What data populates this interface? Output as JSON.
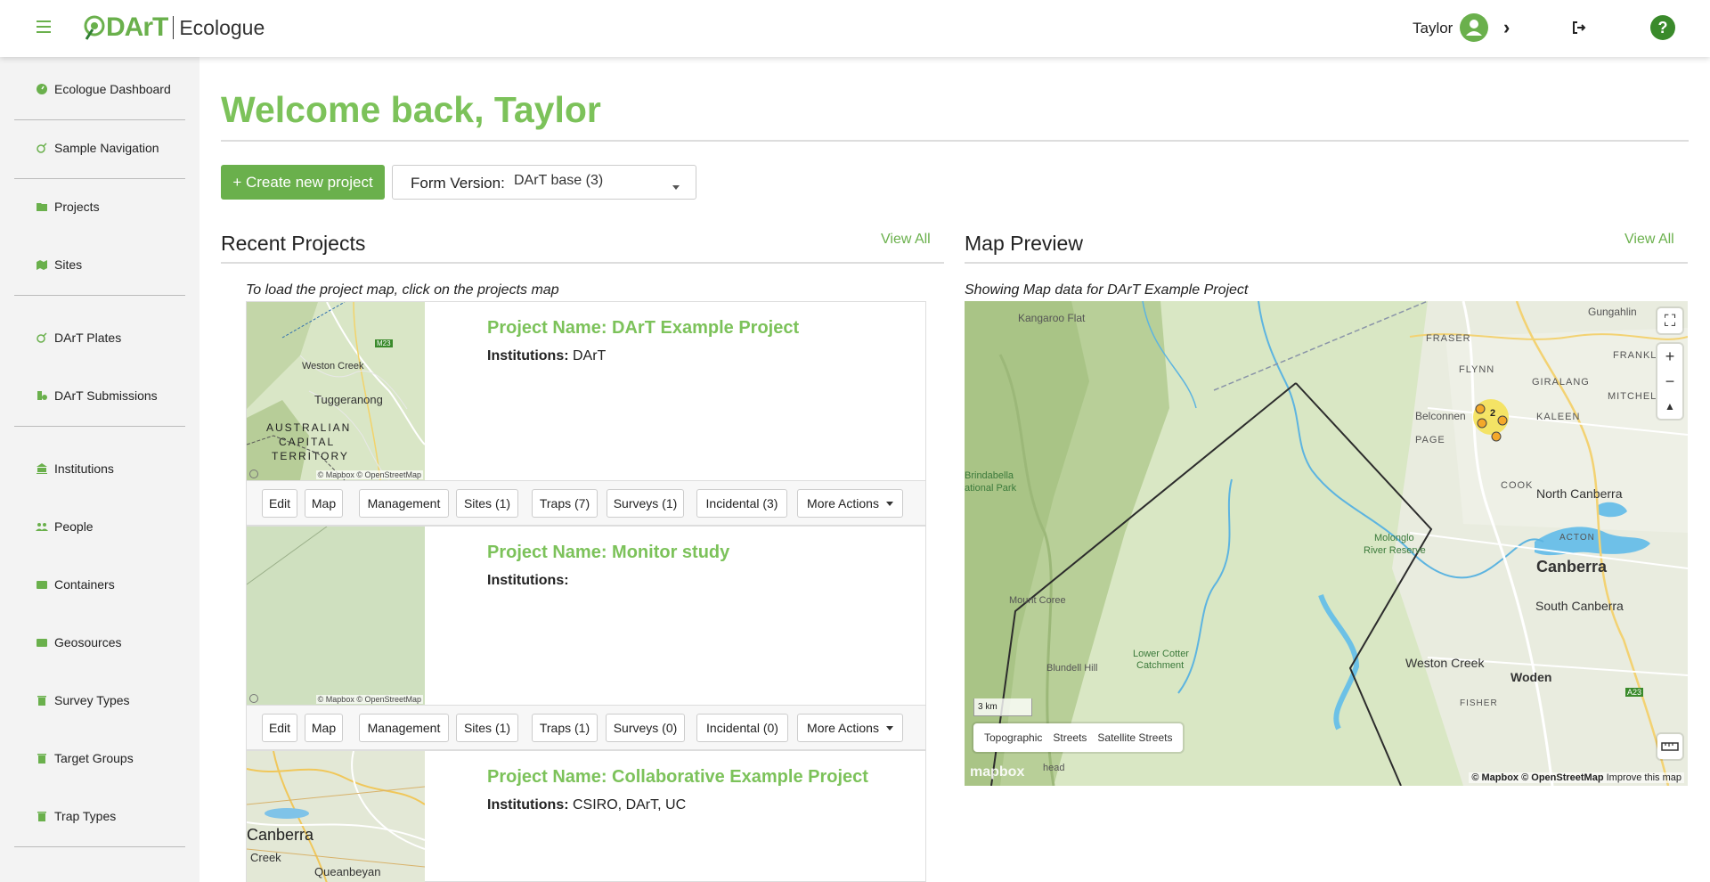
{
  "header": {
    "brand": "DArT",
    "app_name": "Ecologue",
    "user_name": "Taylor",
    "help_label": "?"
  },
  "sidebar": {
    "items": [
      {
        "label": "Ecologue Dashboard",
        "icon": "dashboard-icon"
      },
      {
        "label": "Sample Navigation",
        "icon": "navigation-icon"
      },
      {
        "label": "Projects",
        "icon": "folder-icon"
      },
      {
        "label": "Sites",
        "icon": "map-icon"
      },
      {
        "label": "DArT Plates",
        "icon": "plate-icon"
      },
      {
        "label": "DArT Submissions",
        "icon": "submission-icon"
      },
      {
        "label": "Institutions",
        "icon": "institution-icon"
      },
      {
        "label": "People",
        "icon": "people-icon"
      },
      {
        "label": "Containers",
        "icon": "container-icon"
      },
      {
        "label": "Geosources",
        "icon": "geosource-icon"
      },
      {
        "label": "Survey Types",
        "icon": "trash-icon"
      },
      {
        "label": "Target Groups",
        "icon": "trash-icon"
      },
      {
        "label": "Trap Types",
        "icon": "trash-icon"
      }
    ]
  },
  "main": {
    "welcome": "Welcome back, Taylor",
    "create_button": "+ Create new project",
    "form_version_label": "Form Version:",
    "form_version_value": "DArT base (3)"
  },
  "recent": {
    "title": "Recent Projects",
    "view_all": "View All",
    "note": "To load the project map, click on the projects map",
    "projects": [
      {
        "name": "Project Name: DArT Example Project",
        "institutions_label": "Institutions:",
        "institutions": "DArT",
        "thumb_labels": {
          "a": "Weston Creek",
          "b": "Tuggeranong",
          "c": "AUSTRALIAN",
          "d": "CAPITAL",
          "e": "TERRITORY",
          "f": "M23"
        },
        "attribution": "© Mapbox © OpenStreetMap",
        "actions": [
          "Edit",
          "Map",
          "Management",
          "Sites (1)",
          "Traps (7)",
          "Surveys (1)",
          "Incidental (3)",
          "More Actions"
        ]
      },
      {
        "name": "Project Name: Monitor study",
        "institutions_label": "Institutions:",
        "institutions": "",
        "attribution": "© Mapbox © OpenStreetMap",
        "actions": [
          "Edit",
          "Map",
          "Management",
          "Sites (1)",
          "Traps (1)",
          "Surveys (0)",
          "Incidental (0)",
          "More Actions"
        ]
      },
      {
        "name": "Project Name: Collaborative Example Project",
        "institutions_label": "Institutions:",
        "institutions": "CSIRO, DArT, UC",
        "thumb_labels": {
          "a": "Canberra",
          "b": "Creek",
          "c": "Queanbeyan"
        }
      }
    ]
  },
  "map_preview": {
    "title": "Map Preview",
    "view_all": "View All",
    "note": "Showing Map data for DArT Example Project",
    "cluster_count": "2",
    "labels": {
      "kangaroo_flat": "Kangaroo Flat",
      "gungahlin": "Gungahlin",
      "fraser": "FRASER",
      "franklin": "FRANKLIN",
      "flynn": "FLYNN",
      "giralang": "GIRALANG",
      "mitchell": "MITCHELL",
      "belconnen": "Belconnen",
      "kaleen": "KALEEN",
      "page": "PAGE",
      "cook": "COOK",
      "north_canberra": "North Canberra",
      "brindabella_1": "Brindabella",
      "brindabella_2": "ational Park",
      "acton": "ACTON",
      "canberra": "Canberra",
      "molonglo_1": "Molonglo",
      "molonglo_2": "River Reserve",
      "south_canberra": "South Canberra",
      "mount_coree": "Mount Coree",
      "lower_cotter_1": "Lower Cotter",
      "lower_cotter_2": "Catchment",
      "blundell": "Blundell Hill",
      "weston_creek": "Weston Creek",
      "woden": "Woden",
      "fisher": "FISHER",
      "head": "head",
      "a23": "A23"
    },
    "scale": "3 km",
    "styles": [
      "Topographic",
      "Streets",
      "Satellite Streets"
    ],
    "logo": "mapbox",
    "attribution_1": "© Mapbox",
    "attribution_2": "© OpenStreetMap",
    "attribution_3": "Improve this map"
  },
  "colors": {
    "accent": "#6ab04c",
    "title_green": "#7cc25a",
    "help_green": "#3a8a2b"
  }
}
